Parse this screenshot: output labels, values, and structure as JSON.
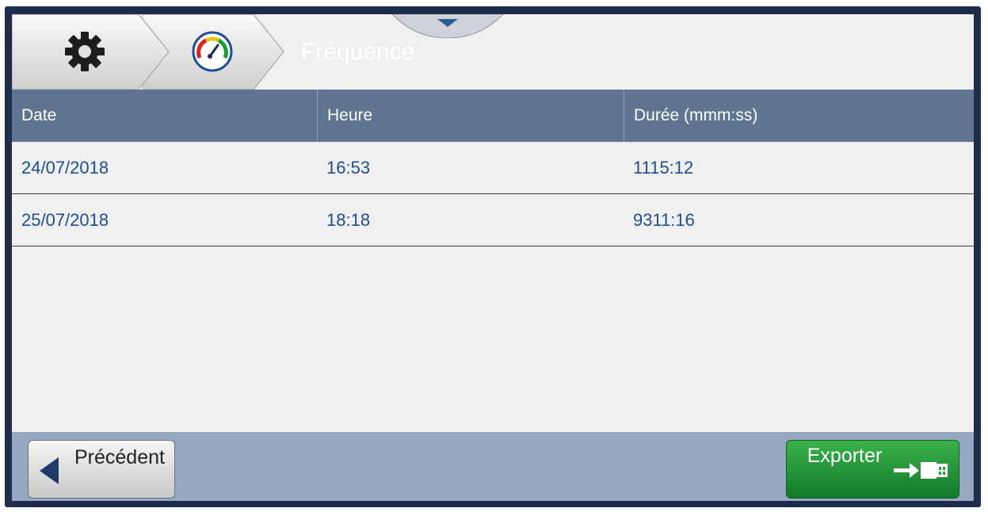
{
  "header": {
    "title": "Fréquence",
    "icons": [
      "gear-icon",
      "gauge-icon"
    ],
    "colors": {
      "bar": "#1f2d4a",
      "crumb": "#e6e6e6"
    }
  },
  "table": {
    "headers": [
      "Date",
      "Heure",
      "Durée (mmm:ss)"
    ],
    "rows": [
      [
        "24/07/2018",
        "16:53",
        "1115:12"
      ],
      [
        "25/07/2018",
        "18:18",
        "9311:16"
      ]
    ]
  },
  "footer": {
    "previous_label": "Précédent",
    "export_label": "Exporter",
    "colors": {
      "export": "#1f9a35",
      "bar": "#97a9c2"
    }
  }
}
